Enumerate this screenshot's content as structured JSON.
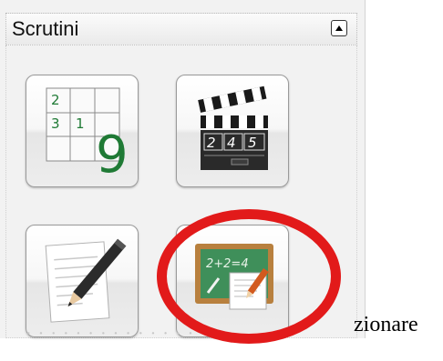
{
  "panel": {
    "title": "Scrutini"
  },
  "tiles": [
    {
      "id": "grid",
      "icon": "number-grid-icon",
      "digits": [
        "2",
        "3",
        "1",
        "9"
      ]
    },
    {
      "id": "clapper",
      "icon": "clapperboard-icon",
      "digits": [
        "2",
        "4",
        "5"
      ]
    },
    {
      "id": "notes",
      "icon": "document-pencil-icon"
    },
    {
      "id": "board",
      "icon": "chalkboard-icon",
      "board_text": "2+2=4"
    }
  ],
  "footer": {
    "visible_text": "zionare"
  },
  "colors": {
    "highlight": "#e21a1a",
    "grid_green": "#1f7a35",
    "board_green": "#3f8f5a"
  }
}
